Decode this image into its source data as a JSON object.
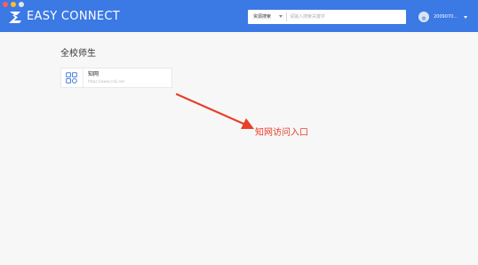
{
  "header": {
    "brand": "EASY CONNECT",
    "search": {
      "type_label": "资源搜索",
      "placeholder": "请输入搜索关键字"
    },
    "user": {
      "name": "2009070..."
    },
    "icons": {
      "brand": "easy-connect-logo-icon",
      "avatar": "user-avatar-icon",
      "search_dropdown": "chevron-down-icon",
      "user_dropdown": "chevron-down-icon"
    }
  },
  "main": {
    "section_title": "全校师生",
    "resources": [
      {
        "title": "知网",
        "url": "https://www.cnki.net",
        "icon": "grid-app-icon"
      }
    ]
  },
  "annotation": {
    "text": "知网访问入口",
    "color": "#e8402a"
  },
  "colors": {
    "header_bg": "#3b79e4",
    "page_bg": "#f7f7f8",
    "accent": "#3b79e4"
  }
}
